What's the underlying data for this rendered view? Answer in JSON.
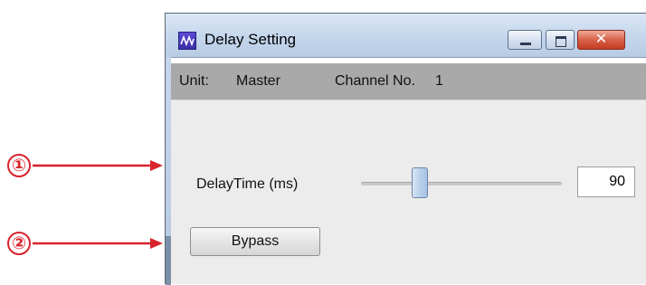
{
  "callouts": [
    {
      "number": "①"
    },
    {
      "number": "②"
    }
  ],
  "window": {
    "title": "Delay Setting",
    "icon": "app-logo-icon",
    "controls": {
      "minimize": "minimize-icon",
      "maximize": "maximize-icon",
      "close": "close-icon",
      "close_glyph": "✕"
    }
  },
  "info": {
    "unit_label": "Unit:",
    "unit_value": "Master",
    "channel_label": "Channel No.",
    "channel_value": "1"
  },
  "delay": {
    "label": "DelayTime (ms)",
    "value": "90"
  },
  "bypass": {
    "label": "Bypass"
  },
  "colors": {
    "callout": "#d8232a",
    "close_button": "#c23c22"
  }
}
